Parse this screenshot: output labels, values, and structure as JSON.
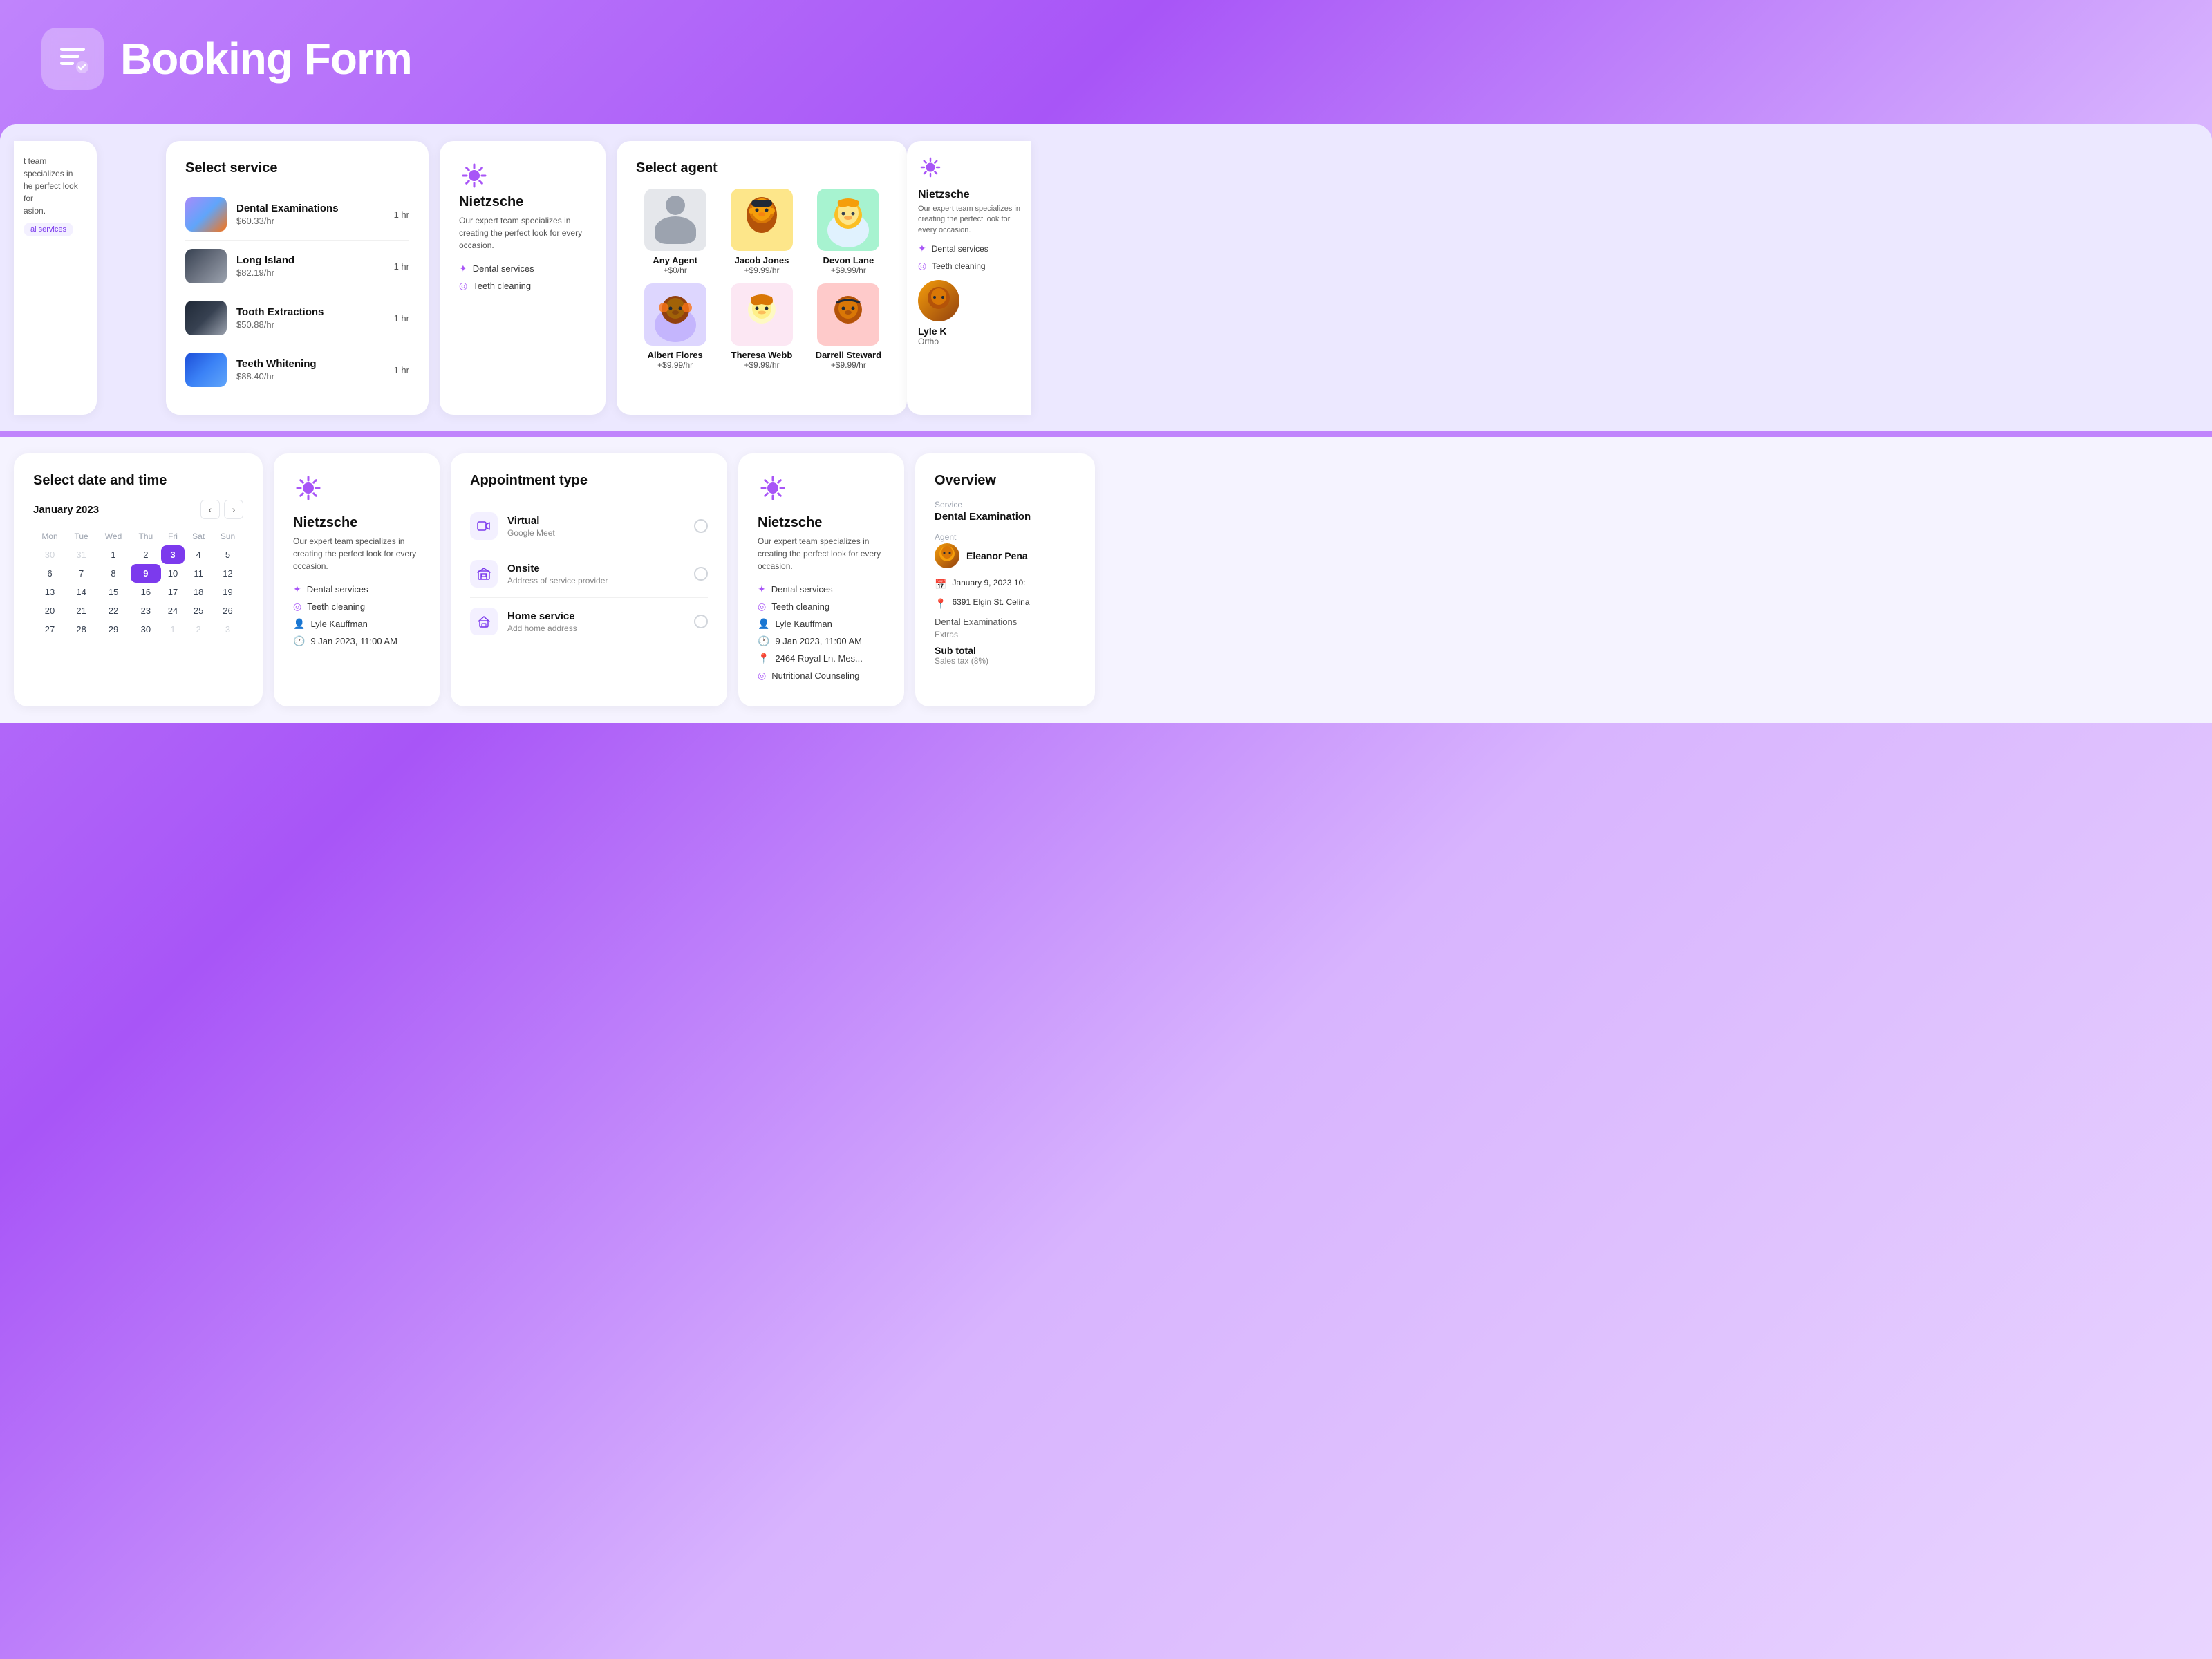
{
  "header": {
    "title": "Booking Form",
    "logo_alt": "Booking form logo"
  },
  "top_row": {
    "partial_left": {
      "line1": "t team specializes in",
      "line2": "he perfect look for",
      "line3": "asion.",
      "tag": "al services"
    },
    "select_service": {
      "title": "Select service",
      "items": [
        {
          "name": "Dental Examinations",
          "price": "$60.33/hr",
          "duration": "1 hr",
          "thumb": "dental"
        },
        {
          "name": "Long Island",
          "price": "$82.19/hr",
          "duration": "1 hr",
          "thumb": "long"
        },
        {
          "name": "Tooth Extractions",
          "price": "$50.88/hr",
          "duration": "1 hr",
          "thumb": "tooth"
        },
        {
          "name": "Teeth Whitening",
          "price": "$88.40/hr",
          "duration": "1 hr",
          "thumb": "whitening"
        }
      ]
    },
    "provider1": {
      "name": "Nietzsche",
      "desc": "Our expert team specializes in creating the perfect look for every occasion.",
      "tags": [
        "Dental services",
        "Teeth cleaning"
      ]
    },
    "select_agent": {
      "title": "Select agent",
      "agents": [
        {
          "name": "Any Agent",
          "price": "+$0/hr",
          "type": "any"
        },
        {
          "name": "Jacob Jones",
          "price": "+$9.99/hr",
          "type": "jacob"
        },
        {
          "name": "Devon Lane",
          "price": "+$9.99/hr",
          "type": "devon"
        },
        {
          "name": "Albert Flores",
          "price": "+$9.99/hr",
          "type": "albert"
        },
        {
          "name": "Theresa Webb",
          "price": "+$9.99/hr",
          "type": "theresa"
        },
        {
          "name": "Darrell Steward",
          "price": "+$9.99/hr",
          "type": "darrell"
        }
      ]
    },
    "partial_right": {
      "provider_name": "Nietzsche",
      "desc": "Our expert team specializes in creating the perfect look for every occasion.",
      "tags": [
        "Dental services",
        "Teeth cleaning"
      ],
      "agent_name": "Lyle K",
      "agent_role": "Ortho"
    }
  },
  "bottom_row": {
    "datetime": {
      "title": "Select date and time",
      "month": "January 2023",
      "days_header": [
        "Mon",
        "Tue",
        "Wed",
        "Thu",
        "Fri",
        "Sat",
        "Sun"
      ],
      "weeks": [
        [
          "30",
          "31",
          "1",
          "2",
          "3",
          "4",
          "5"
        ],
        [
          "6",
          "7",
          "8",
          "9",
          "10",
          "11",
          "12"
        ],
        [
          "13",
          "14",
          "15",
          "16",
          "17",
          "18",
          "19"
        ],
        [
          "20",
          "21",
          "22",
          "23",
          "24",
          "25",
          "26"
        ],
        [
          "27",
          "28",
          "29",
          "30",
          "1",
          "2",
          "3"
        ]
      ],
      "other_month_first_row": [
        0,
        1
      ],
      "selected_day": "9",
      "today_day": "3"
    },
    "provider2": {
      "name": "Nietzsche",
      "desc": "Our expert team specializes in creating the perfect look for every occasion.",
      "tags": [
        "Dental services",
        "Teeth cleaning",
        "Lyle Kauffman",
        "9 Jan 2023, 11:00 AM"
      ]
    },
    "appointment_type": {
      "title": "Appointment type",
      "options": [
        {
          "type": "virtual",
          "label": "Virtual",
          "sublabel": "Google Meet",
          "icon": "📹"
        },
        {
          "type": "onsite",
          "label": "Onsite",
          "sublabel": "Address of service provider",
          "icon": "🏢"
        },
        {
          "type": "home",
          "label": "Home service",
          "sublabel": "Add home address",
          "icon": "🏠"
        }
      ]
    },
    "provider3": {
      "name": "Nietzsche",
      "desc": "Our expert team specializes in creating the perfect look for every occasion.",
      "tags": [
        "Dental services",
        "Teeth cleaning",
        "Lyle Kauffman",
        "9 Jan 2023, 11:00 AM",
        "2464 Royal Ln. Mes...",
        "Nutritional Counseling"
      ]
    },
    "overview": {
      "title": "Overview",
      "service_label": "Service",
      "service_value": "Dental Examination",
      "agent_label": "Agent",
      "agent_name": "Eleanor Pena",
      "date_value": "January 9, 2023  10:",
      "address_value": "6391 Elgin St. Celina",
      "extras_label": "Dental Examinations",
      "extras_sub": "Extras",
      "subtotal_label": "Sub total",
      "tax_label": "Sales tax (8%)"
    }
  }
}
